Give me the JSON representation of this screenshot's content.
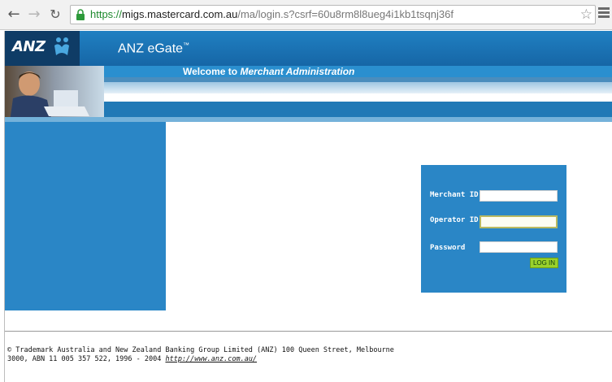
{
  "browser": {
    "url_scheme": "https://",
    "url_host": "migs.mastercard.com.au",
    "url_path": "/ma/login.s?csrf=60u8rm8l8ueg4i1kb1tsqnj36f",
    "icons": {
      "back": "back-arrow-icon",
      "forward": "forward-arrow-icon",
      "reload": "reload-icon",
      "lock": "lock-icon",
      "star": "star-icon",
      "menu": "hamburger-menu-icon"
    },
    "colors": {
      "secure": "#1f8a2f"
    }
  },
  "header": {
    "logo_text": "ANZ",
    "product_name": "ANZ eGate",
    "product_tm": "™",
    "welcome_prefix": "Welcome to ",
    "welcome_emphasis": "Merchant Administration",
    "colors": {
      "brand": "#1666a6",
      "dark": "#0f3c66",
      "accent": "#2a86c6"
    }
  },
  "login": {
    "merchant_id_label": "Merchant ID",
    "merchant_id_value": "",
    "operator_id_label": "Operator ID",
    "operator_id_value": "",
    "password_label": "Password",
    "password_value": "",
    "submit_label": "LOG IN",
    "colors": {
      "panel": "#2a86c6",
      "button": "#9ad12b"
    }
  },
  "footer": {
    "line1": "© Trademark Australia and New Zealand Banking Group Limited (ANZ) 100 Queen Street, Melbourne",
    "line2": "3000, ABN 11 005 357 522, 1996 - 2004 ",
    "link_text": "http://www.anz.com.au/"
  }
}
